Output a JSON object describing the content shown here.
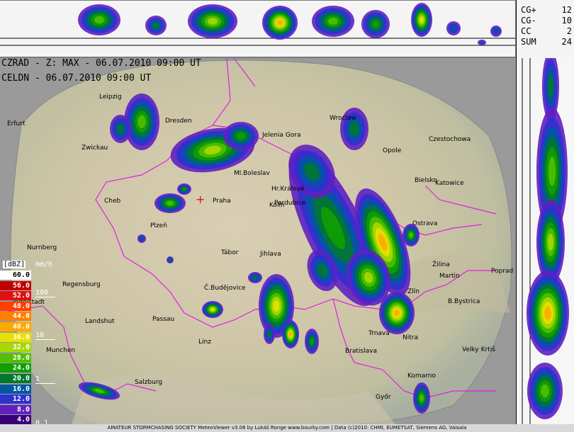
{
  "header": {
    "line1": "CZRAD - Z: MAX - 06.07.2010 09:00 UT",
    "line2": "CELDN - 06.07.2010 09:00 UT"
  },
  "lightning": {
    "rows": [
      {
        "label": "CG+",
        "value": "12"
      },
      {
        "label": "CG-",
        "value": "10"
      },
      {
        "label": "CC",
        "value": "2"
      },
      {
        "label": "SUM",
        "value": "24"
      }
    ]
  },
  "cities": [
    {
      "name": "Leipzig"
    },
    {
      "name": "Erfurt"
    },
    {
      "name": "Dresden"
    },
    {
      "name": "Jelenia Gora"
    },
    {
      "name": "Wroclaw"
    },
    {
      "name": "Czestochowa"
    },
    {
      "name": "Zwickau"
    },
    {
      "name": "Opole"
    },
    {
      "name": "Ml.Boleslav"
    },
    {
      "name": "Bielsko"
    },
    {
      "name": "Katowice"
    },
    {
      "name": "Hr.Králové"
    },
    {
      "name": "Cheb"
    },
    {
      "name": "Praha"
    },
    {
      "name": "Kolín"
    },
    {
      "name": "Pardubice"
    },
    {
      "name": "Ostrava"
    },
    {
      "name": "Plzeň"
    },
    {
      "name": "Nurnberg"
    },
    {
      "name": "Tábor"
    },
    {
      "name": "Jihlava"
    },
    {
      "name": "Žilina"
    },
    {
      "name": "Martin"
    },
    {
      "name": "Poprad"
    },
    {
      "name": "Regensburg"
    },
    {
      "name": "Č.Budějovice"
    },
    {
      "name": "Zlín"
    },
    {
      "name": "Ingolstadt"
    },
    {
      "name": "B.Bystrica"
    },
    {
      "name": "Passau"
    },
    {
      "name": "Landshut"
    },
    {
      "name": "Trnava"
    },
    {
      "name": "Linz"
    },
    {
      "name": "Munchen"
    },
    {
      "name": "Nitra"
    },
    {
      "name": "Bratislava"
    },
    {
      "name": "Velky Krtiš"
    },
    {
      "name": "Salzburg"
    },
    {
      "name": "Komarno"
    },
    {
      "name": "Győr"
    }
  ],
  "legend": {
    "title": "[dBZ]",
    "rate_title": "mm/h",
    "items": [
      {
        "label": "60.0",
        "color": "#ffffff"
      },
      {
        "label": "56.0",
        "color": "#c00000"
      },
      {
        "label": "52.0",
        "color": "#e01010"
      },
      {
        "label": "48.0",
        "color": "#ff4000"
      },
      {
        "label": "44.0",
        "color": "#ff8000"
      },
      {
        "label": "40.0",
        "color": "#ffa800"
      },
      {
        "label": "36.0",
        "color": "#e8e000"
      },
      {
        "label": "32.0",
        "color": "#a8d800"
      },
      {
        "label": "28.0",
        "color": "#50c000"
      },
      {
        "label": "24.0",
        "color": "#10a000"
      },
      {
        "label": "20.0",
        "color": "#007830"
      },
      {
        "label": "16.0",
        "color": "#0058a0"
      },
      {
        "label": "12.0",
        "color": "#3030d0"
      },
      {
        "label": "8.0",
        "color": "#6020c0"
      },
      {
        "label": "4.0",
        "color": "#3a0078"
      }
    ],
    "rates": [
      "100",
      "10",
      "1",
      "0.1"
    ]
  },
  "footer": "AMATEUR STORMCHASING SOCIETY MeteoViewer v3.06 by Lukáš Ronge www.bourky.com | Data (c)2010: CHMI, EUMETSAT, Siemens AG, Vaisala"
}
